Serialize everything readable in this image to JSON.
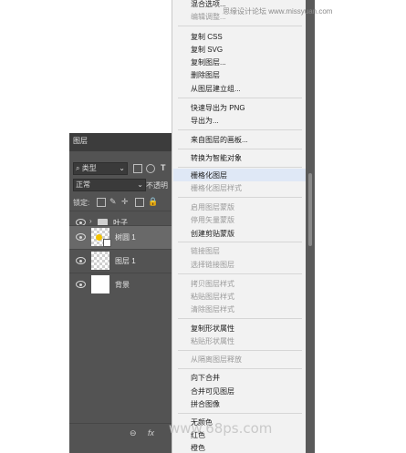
{
  "layers_panel": {
    "tab_label": "图层",
    "filter_kind": "类型",
    "blend_mode": "正常",
    "opacity_label": "不透明",
    "lock_label": "锁定:",
    "layers": [
      {
        "name": "叶子",
        "type": "group",
        "selected": false
      },
      {
        "name": "树圆 1",
        "type": "shape",
        "selected": true
      },
      {
        "name": "图层 1",
        "type": "pixel",
        "selected": false
      },
      {
        "name": "背景",
        "type": "background",
        "selected": false
      }
    ],
    "bottom_icons": [
      "link-icon",
      "fx-icon"
    ]
  },
  "context_menu": {
    "items": [
      {
        "label": "混合选项...",
        "enabled": true
      },
      {
        "label": "编辑调整...",
        "enabled": false
      },
      {
        "label": "复制 CSS",
        "enabled": true
      },
      {
        "label": "复制 SVG",
        "enabled": true
      },
      {
        "label": "复制图层...",
        "enabled": true
      },
      {
        "label": "删除图层",
        "enabled": true
      },
      {
        "label": "从图层建立组...",
        "enabled": true
      },
      {
        "label": "快速导出为 PNG",
        "enabled": true
      },
      {
        "label": "导出为...",
        "enabled": true
      },
      {
        "label": "来自图层的画板...",
        "enabled": true
      },
      {
        "label": "转换为智能对象",
        "enabled": true
      },
      {
        "label": "栅格化图层",
        "enabled": true,
        "highlighted": true
      },
      {
        "label": "栅格化图层样式",
        "enabled": false
      },
      {
        "label": "启用图层蒙版",
        "enabled": false
      },
      {
        "label": "停用矢量蒙版",
        "enabled": false
      },
      {
        "label": "创建剪贴蒙版",
        "enabled": true
      },
      {
        "label": "链接图层",
        "enabled": false
      },
      {
        "label": "选择链接图层",
        "enabled": false
      },
      {
        "label": "拷贝图层样式",
        "enabled": false
      },
      {
        "label": "粘贴图层样式",
        "enabled": false
      },
      {
        "label": "清除图层样式",
        "enabled": false
      },
      {
        "label": "复制形状属性",
        "enabled": true
      },
      {
        "label": "粘贴形状属性",
        "enabled": false
      },
      {
        "label": "从隔离图层释放",
        "enabled": false
      },
      {
        "label": "向下合并",
        "enabled": true
      },
      {
        "label": "合并可见图层",
        "enabled": true
      },
      {
        "label": "拼合图像",
        "enabled": true
      },
      {
        "label": "无颜色",
        "enabled": true
      },
      {
        "label": "红色",
        "enabled": true
      },
      {
        "label": "橙色",
        "enabled": true
      }
    ]
  },
  "watermarks": {
    "top": "思缘设计论坛 www.missyuan.com",
    "bottom": "www.68ps.com"
  },
  "colors": {
    "menu_bg": "#f2f2f2",
    "menu_highlight": "#dfe8f6",
    "panel_bg": "#535353"
  }
}
